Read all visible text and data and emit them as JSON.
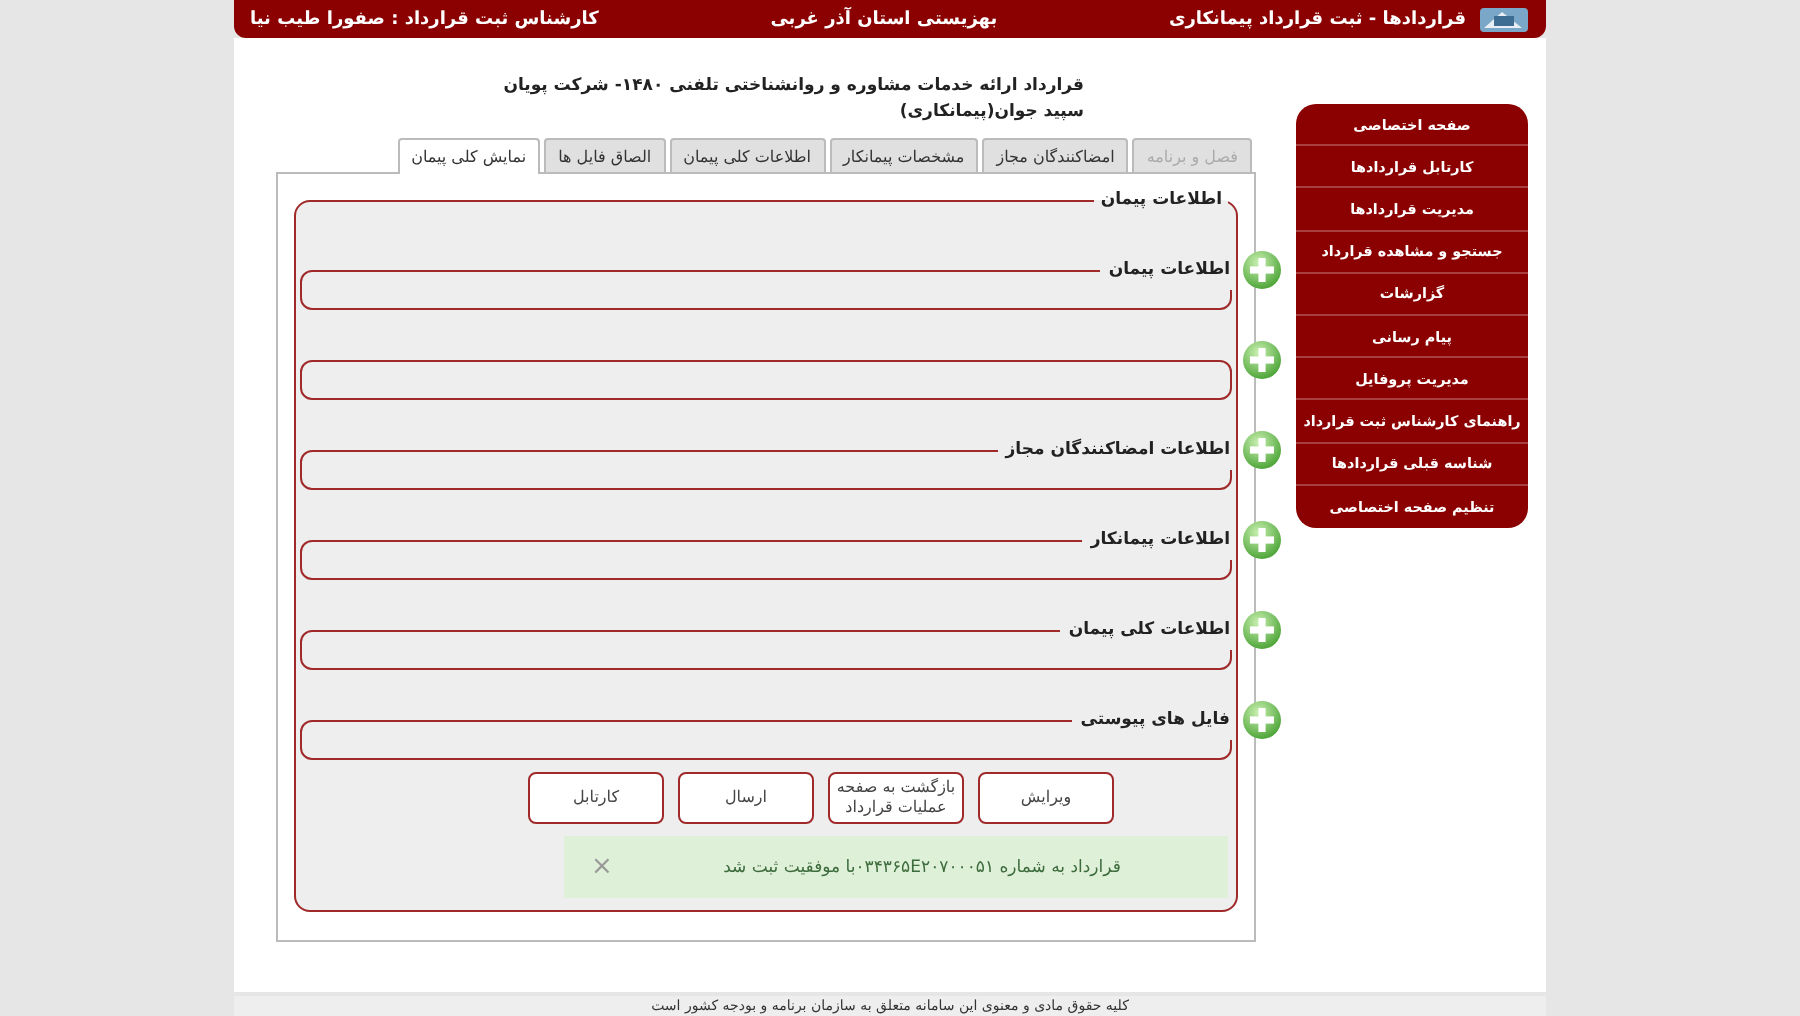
{
  "header": {
    "app_title": "قراردادها - ثبت قرارداد پیمانکاری",
    "organization": "بهزیستی استان آذر غربی",
    "user": "کارشناس ثبت قرارداد : صفورا طیب نیا"
  },
  "contract_title": "قرارداد ارائه خدمات مشاوره و روانشناختی تلفنی ۱۴۸۰- شرکت پویان سپید جوان(پیمانکاری)",
  "tabs": [
    {
      "label": "فصل و برنامه",
      "selected": false,
      "disabled": true
    },
    {
      "label": "امضاکنندگان مجاز",
      "selected": false,
      "disabled": false
    },
    {
      "label": "مشخصات پیمانکار",
      "selected": false,
      "disabled": false
    },
    {
      "label": "اطلاعات کلی پیمان",
      "selected": false,
      "disabled": false
    },
    {
      "label": "الصاق فایل ها",
      "selected": false,
      "disabled": false
    },
    {
      "label": "نمایش کلی پیمان",
      "selected": true,
      "disabled": false
    }
  ],
  "main_section": {
    "legend": "اطلاعات پیمان",
    "subsections": [
      {
        "kind": "section",
        "legend": "اطلاعات پیمان"
      },
      {
        "kind": "section"
      },
      {
        "kind": "section",
        "legend": "اطلاعات امضاکنندگان مجاز"
      },
      {
        "kind": "section",
        "legend": "اطلاعات پیمانکار"
      },
      {
        "kind": "section",
        "legend": "اطلاعات کلی پیمان"
      },
      {
        "kind": "section",
        "legend": "فایل های پیوستی"
      }
    ]
  },
  "buttons": [
    {
      "label": "ویرایش"
    },
    {
      "label": "بازگشت به صفحه عملیات قرارداد"
    },
    {
      "label": "ارسال"
    },
    {
      "label": "کارتابل"
    }
  ],
  "alert": {
    "message": "قرارداد به شماره ۰۳۴۳۶۵E۲۰۷۰۰۰۵۱با موفقیت ثبت شد",
    "close": "×"
  },
  "sidebar": {
    "items": [
      "صفحه اختصاصی",
      "کارتابل قراردادها",
      "مدیریت قراردادها",
      "جستجو و مشاهده قرارداد",
      "گزارشات",
      "پیام رسانی",
      "مدیریت پروفایل",
      "راهنمای کارشناس ثبت قرارداد",
      "شناسه قبلی قراردادها",
      "تنظیم صفحه اختصاصی"
    ]
  },
  "footer": "کلیه حقوق مادی و معنوی این سامانه متعلق به سازمان برنامه و بودجه کشور است"
}
